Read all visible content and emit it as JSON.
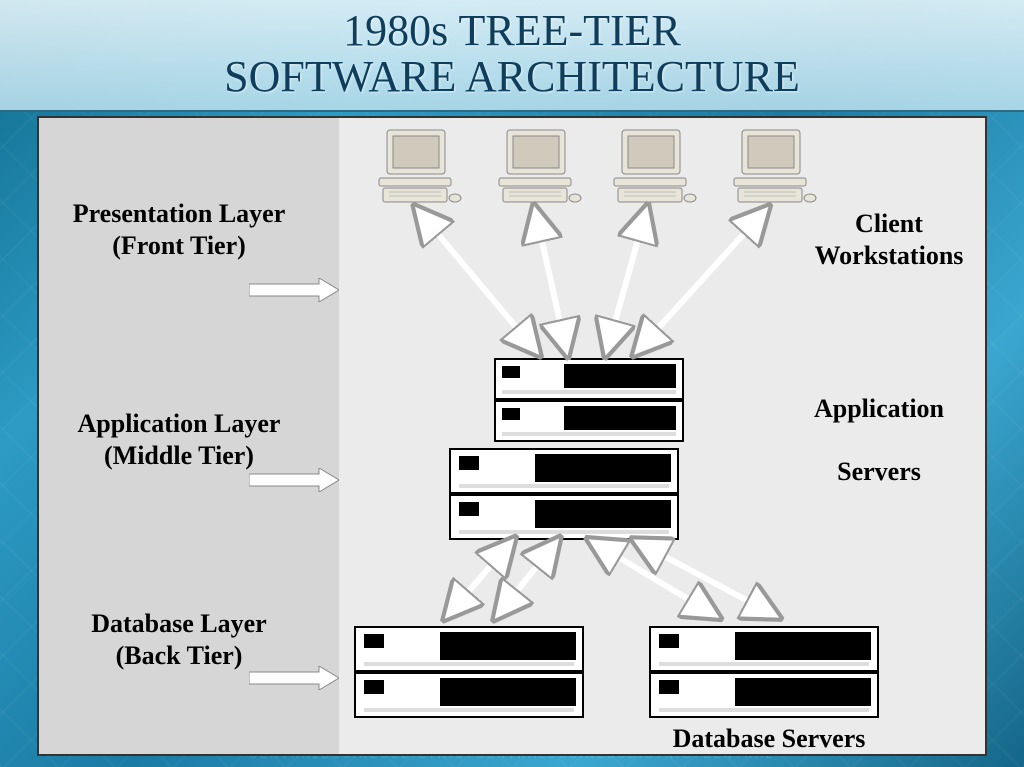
{
  "title": {
    "line1": "1980s TREE-TIER",
    "line2": "SOFTWARE ARCHITECTURE"
  },
  "layers": {
    "presentation": {
      "name": "Presentation Layer",
      "tier": "(Front Tier)"
    },
    "application": {
      "name": "Application Layer",
      "tier": "(Middle Tier)"
    },
    "database": {
      "name": "Database Layer",
      "tier": "(Back Tier)"
    }
  },
  "right_labels": {
    "client1": "Client",
    "client2": "Workstations",
    "app1": "Application",
    "app2": "Servers",
    "db": "Database Servers"
  },
  "watermark": "CENTRALBUSINESSDISTRICTCENTRALBUSINESSDISTRICTCENTRAL"
}
